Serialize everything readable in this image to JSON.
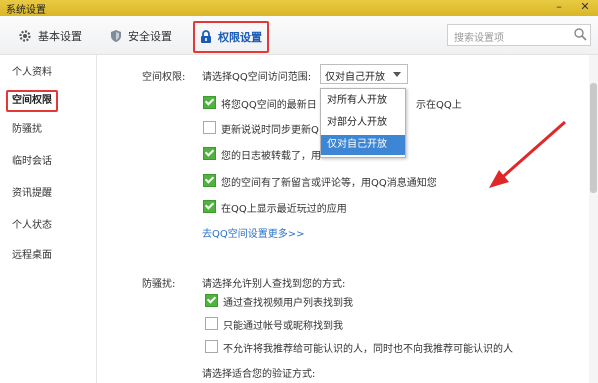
{
  "window": {
    "title": "系统设置",
    "min_symbol": "–",
    "close_symbol": "✕"
  },
  "toolbar": {
    "tabs": [
      {
        "label": "基本设置",
        "icon": "gear-icon"
      },
      {
        "label": "安全设置",
        "icon": "shield-icon"
      },
      {
        "label": "权限设置",
        "icon": "lock-icon"
      }
    ],
    "search_placeholder": "搜索设置项"
  },
  "sidebar": {
    "items": [
      {
        "label": "个人资料"
      },
      {
        "label": "空间权限"
      },
      {
        "label": "防骚扰"
      },
      {
        "label": "临时会话"
      },
      {
        "label": "资讯提醒"
      },
      {
        "label": "个人状态"
      },
      {
        "label": "远程桌面"
      }
    ],
    "active": "空间权限"
  },
  "space": {
    "section_label": "空间权限:",
    "range_label": "请选择QQ空间访问范围:",
    "selected_value": "仅对自己开放",
    "dropdown_options": [
      "对所有人开放",
      "对部分人开放",
      "仅对自己开放"
    ],
    "options": [
      {
        "text": "将您QQ空间的最新日",
        "suffix": "示在QQ上",
        "checked": true
      },
      {
        "text": "更新说说时同步更新Q",
        "checked": false
      },
      {
        "text": "您的日志被转载了，用",
        "checked": true
      },
      {
        "text": "您的空间有了新留言或评论等，用QQ消息通知您",
        "checked": true
      },
      {
        "text": "在QQ上显示最近玩过的应用",
        "checked": true
      }
    ],
    "more_link": "去QQ空间设置更多>>"
  },
  "antispam": {
    "section_label": "防骚扰:",
    "find_label": "请选择允许别人查找到您的方式:",
    "options": [
      {
        "text": "通过查找视频用户列表找到我",
        "checked": true
      },
      {
        "text": "只能通过帐号或昵称找到我",
        "checked": false
      },
      {
        "text": "不允许将我推荐给可能认识的人，同时也不向我推荐可能认识的人",
        "checked": false
      }
    ],
    "verify_label": "请选择适合您的验证方式:"
  }
}
